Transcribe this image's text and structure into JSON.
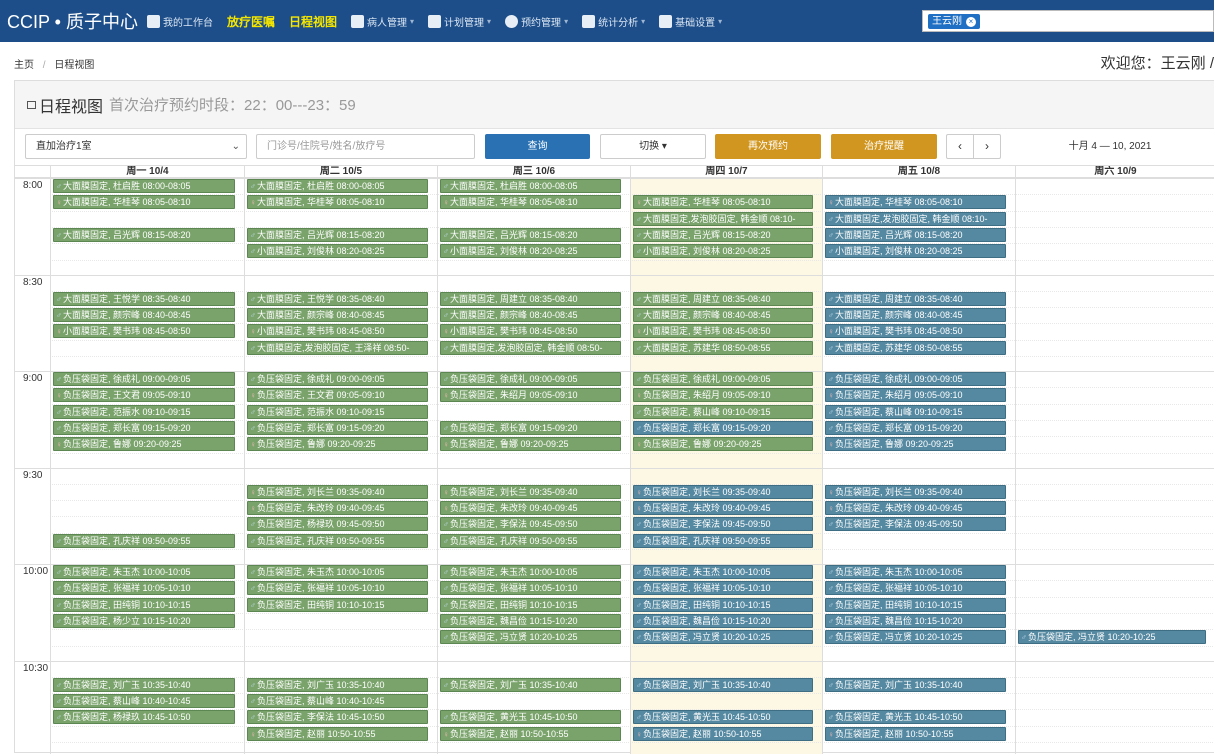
{
  "navbar": {
    "brand": "CCIP • 质子中心",
    "items": [
      {
        "label": "我的工作台",
        "icon": "home-icon",
        "highlight": false,
        "caret": false
      },
      {
        "label": "放疗医嘱",
        "icon": "",
        "highlight": true,
        "caret": false
      },
      {
        "label": "日程视图",
        "icon": "",
        "highlight": true,
        "caret": false
      },
      {
        "label": "病人管理",
        "icon": "user-icon",
        "highlight": false,
        "caret": true
      },
      {
        "label": "计划管理",
        "icon": "monitor-icon",
        "highlight": false,
        "caret": true
      },
      {
        "label": "预约管理",
        "icon": "clock-icon",
        "highlight": false,
        "caret": true
      },
      {
        "label": "统计分析",
        "icon": "bar-chart-icon",
        "highlight": false,
        "caret": true
      },
      {
        "label": "基础设置",
        "icon": "users-icon",
        "highlight": false,
        "caret": true
      }
    ],
    "user_tag": "王云刚",
    "user_tag_close": "×"
  },
  "breadcrumb": {
    "home": "主页",
    "separator": "/",
    "current": "日程视图"
  },
  "welcome": "欢迎您：王云刚 /",
  "panel": {
    "title": "日程视图",
    "subtitle": "首次治疗预约时段：22：00---23：59"
  },
  "toolbar": {
    "room_select": "直加治疗1室",
    "search_placeholder": "门诊号/住院号/姓名/放疗号",
    "query_button": "查询",
    "switch_button": "切换 ▾",
    "rebook_button": "再次预约",
    "remind_button": "治疗提醒",
    "prev_icon": "‹",
    "next_icon": "›",
    "date_range": "十月 4 — 10, 2021"
  },
  "calendar": {
    "today_col": 3,
    "days": [
      "周一 10/4",
      "周二 10/5",
      "周三 10/6",
      "周四 10/7",
      "周五 10/8",
      "周六 10/9"
    ],
    "time_labels": [
      "8:00",
      "8:30",
      "9:00",
      "9:30",
      "10:00",
      "10:30"
    ],
    "colors": {
      "green": "#7aa36b",
      "blue": "#5589a1",
      "today": "#fcf8e3",
      "nav": "#1d4e89"
    },
    "events": [
      {
        "d": 0,
        "s": 0,
        "t": "大面膜固定, 杜启胜 08:00-08:05",
        "c": "green",
        "sex": "m"
      },
      {
        "d": 0,
        "s": 1,
        "t": "大面膜固定, 华桂琴 08:05-08:10",
        "c": "green",
        "sex": "f"
      },
      {
        "d": 0,
        "s": 3,
        "t": "大面膜固定, 吕光辉 08:15-08:20",
        "c": "green",
        "sex": "m"
      },
      {
        "d": 0,
        "s": 7,
        "t": "大面膜固定, 王悦学 08:35-08:40",
        "c": "green",
        "sex": "m"
      },
      {
        "d": 0,
        "s": 8,
        "t": "大面膜固定, 颜宗峰 08:40-08:45",
        "c": "green",
        "sex": "m"
      },
      {
        "d": 0,
        "s": 9,
        "t": "小面膜固定, 樊书玮 08:45-08:50",
        "c": "green",
        "sex": "f"
      },
      {
        "d": 0,
        "s": 12,
        "t": "负压袋固定, 徐成礼 09:00-09:05",
        "c": "green",
        "sex": "m"
      },
      {
        "d": 0,
        "s": 13,
        "t": "负压袋固定, 王文君 09:05-09:10",
        "c": "green",
        "sex": "f"
      },
      {
        "d": 0,
        "s": 14,
        "t": "负压袋固定, 范振水 09:10-09:15",
        "c": "green",
        "sex": "m"
      },
      {
        "d": 0,
        "s": 15,
        "t": "负压袋固定, 郑长富 09:15-09:20",
        "c": "green",
        "sex": "m"
      },
      {
        "d": 0,
        "s": 16,
        "t": "负压袋固定, 鲁娜 09:20-09:25",
        "c": "green",
        "sex": "f"
      },
      {
        "d": 0,
        "s": 22,
        "t": "负压袋固定, 孔庆祥 09:50-09:55",
        "c": "green",
        "sex": "m"
      },
      {
        "d": 0,
        "s": 24,
        "t": "负压袋固定, 朱玉杰 10:00-10:05",
        "c": "green",
        "sex": "m"
      },
      {
        "d": 0,
        "s": 25,
        "t": "负压袋固定, 张福祥 10:05-10:10",
        "c": "green",
        "sex": "m"
      },
      {
        "d": 0,
        "s": 26,
        "t": "负压袋固定, 田纯铜 10:10-10:15",
        "c": "green",
        "sex": "m"
      },
      {
        "d": 0,
        "s": 27,
        "t": "负压袋固定, 杨少立 10:15-10:20",
        "c": "green",
        "sex": "m"
      },
      {
        "d": 0,
        "s": 31,
        "t": "负压袋固定, 刘广玉 10:35-10:40",
        "c": "green",
        "sex": "m"
      },
      {
        "d": 0,
        "s": 32,
        "t": "负压袋固定, 蔡山峰 10:40-10:45",
        "c": "green",
        "sex": "m"
      },
      {
        "d": 0,
        "s": 33,
        "t": "负压袋固定, 杨禄玖 10:45-10:50",
        "c": "green",
        "sex": "m"
      },
      {
        "d": 1,
        "s": 0,
        "t": "大面膜固定, 杜启胜 08:00-08:05",
        "c": "green",
        "sex": "m"
      },
      {
        "d": 1,
        "s": 1,
        "t": "大面膜固定, 华桂琴 08:05-08:10",
        "c": "green",
        "sex": "f"
      },
      {
        "d": 1,
        "s": 3,
        "t": "大面膜固定, 吕光辉 08:15-08:20",
        "c": "green",
        "sex": "m"
      },
      {
        "d": 1,
        "s": 4,
        "t": "小面膜固定, 刘俊林 08:20-08:25",
        "c": "green",
        "sex": "m"
      },
      {
        "d": 1,
        "s": 7,
        "t": "大面膜固定, 王悦学 08:35-08:40",
        "c": "green",
        "sex": "m"
      },
      {
        "d": 1,
        "s": 8,
        "t": "大面膜固定, 颜宗峰 08:40-08:45",
        "c": "green",
        "sex": "m"
      },
      {
        "d": 1,
        "s": 9,
        "t": "小面膜固定, 樊书玮 08:45-08:50",
        "c": "green",
        "sex": "f"
      },
      {
        "d": 1,
        "s": 10,
        "t": "大面膜固定,发泡胶固定, 王泽祥 08:50-",
        "c": "green",
        "sex": "m"
      },
      {
        "d": 1,
        "s": 12,
        "t": "负压袋固定, 徐成礼 09:00-09:05",
        "c": "green",
        "sex": "m"
      },
      {
        "d": 1,
        "s": 13,
        "t": "负压袋固定, 王文君 09:05-09:10",
        "c": "green",
        "sex": "f"
      },
      {
        "d": 1,
        "s": 14,
        "t": "负压袋固定, 范振水 09:10-09:15",
        "c": "green",
        "sex": "m"
      },
      {
        "d": 1,
        "s": 15,
        "t": "负压袋固定, 郑长富 09:15-09:20",
        "c": "green",
        "sex": "m"
      },
      {
        "d": 1,
        "s": 16,
        "t": "负压袋固定, 鲁娜 09:20-09:25",
        "c": "green",
        "sex": "f"
      },
      {
        "d": 1,
        "s": 19,
        "t": "负压袋固定, 刘长兰 09:35-09:40",
        "c": "green",
        "sex": "f"
      },
      {
        "d": 1,
        "s": 20,
        "t": "负压袋固定, 朱改玲 09:40-09:45",
        "c": "green",
        "sex": "f"
      },
      {
        "d": 1,
        "s": 21,
        "t": "负压袋固定, 杨禄玖 09:45-09:50",
        "c": "green",
        "sex": "m"
      },
      {
        "d": 1,
        "s": 22,
        "t": "负压袋固定, 孔庆祥 09:50-09:55",
        "c": "green",
        "sex": "m"
      },
      {
        "d": 1,
        "s": 24,
        "t": "负压袋固定, 朱玉杰 10:00-10:05",
        "c": "green",
        "sex": "m"
      },
      {
        "d": 1,
        "s": 25,
        "t": "负压袋固定, 张福祥 10:05-10:10",
        "c": "green",
        "sex": "m"
      },
      {
        "d": 1,
        "s": 26,
        "t": "负压袋固定, 田纯铜 10:10-10:15",
        "c": "green",
        "sex": "m"
      },
      {
        "d": 1,
        "s": 31,
        "t": "负压袋固定, 刘广玉 10:35-10:40",
        "c": "green",
        "sex": "m"
      },
      {
        "d": 1,
        "s": 32,
        "t": "负压袋固定, 蔡山峰 10:40-10:45",
        "c": "green",
        "sex": "m"
      },
      {
        "d": 1,
        "s": 33,
        "t": "负压袋固定, 李保法 10:45-10:50",
        "c": "green",
        "sex": "m"
      },
      {
        "d": 1,
        "s": 34,
        "t": "负压袋固定, 赵丽 10:50-10:55",
        "c": "green",
        "sex": "f"
      },
      {
        "d": 2,
        "s": 0,
        "t": "大面膜固定, 杜启胜 08:00-08:05",
        "c": "green",
        "sex": "m"
      },
      {
        "d": 2,
        "s": 1,
        "t": "大面膜固定, 华桂琴 08:05-08:10",
        "c": "green",
        "sex": "f"
      },
      {
        "d": 2,
        "s": 3,
        "t": "大面膜固定, 吕光辉 08:15-08:20",
        "c": "green",
        "sex": "m"
      },
      {
        "d": 2,
        "s": 4,
        "t": "小面膜固定, 刘俊林 08:20-08:25",
        "c": "green",
        "sex": "m"
      },
      {
        "d": 2,
        "s": 7,
        "t": "大面膜固定, 周建立 08:35-08:40",
        "c": "green",
        "sex": "m"
      },
      {
        "d": 2,
        "s": 8,
        "t": "大面膜固定, 颜宗峰 08:40-08:45",
        "c": "green",
        "sex": "m"
      },
      {
        "d": 2,
        "s": 9,
        "t": "小面膜固定, 樊书玮 08:45-08:50",
        "c": "green",
        "sex": "f"
      },
      {
        "d": 2,
        "s": 10,
        "t": "大面膜固定,发泡胶固定, 韩金顺 08:50-",
        "c": "green",
        "sex": "m"
      },
      {
        "d": 2,
        "s": 12,
        "t": "负压袋固定, 徐成礼 09:00-09:05",
        "c": "green",
        "sex": "m"
      },
      {
        "d": 2,
        "s": 13,
        "t": "负压袋固定, 朱绍月 09:05-09:10",
        "c": "green",
        "sex": "f"
      },
      {
        "d": 2,
        "s": 15,
        "t": "负压袋固定, 郑长富 09:15-09:20",
        "c": "green",
        "sex": "m"
      },
      {
        "d": 2,
        "s": 16,
        "t": "负压袋固定, 鲁娜 09:20-09:25",
        "c": "green",
        "sex": "f"
      },
      {
        "d": 2,
        "s": 19,
        "t": "负压袋固定, 刘长兰 09:35-09:40",
        "c": "green",
        "sex": "f"
      },
      {
        "d": 2,
        "s": 20,
        "t": "负压袋固定, 朱改玲 09:40-09:45",
        "c": "green",
        "sex": "f"
      },
      {
        "d": 2,
        "s": 21,
        "t": "负压袋固定, 李保法 09:45-09:50",
        "c": "green",
        "sex": "m"
      },
      {
        "d": 2,
        "s": 22,
        "t": "负压袋固定, 孔庆祥 09:50-09:55",
        "c": "green",
        "sex": "m"
      },
      {
        "d": 2,
        "s": 24,
        "t": "负压袋固定, 朱玉杰 10:00-10:05",
        "c": "green",
        "sex": "m"
      },
      {
        "d": 2,
        "s": 25,
        "t": "负压袋固定, 张福祥 10:05-10:10",
        "c": "green",
        "sex": "m"
      },
      {
        "d": 2,
        "s": 26,
        "t": "负压袋固定, 田纯铜 10:10-10:15",
        "c": "green",
        "sex": "m"
      },
      {
        "d": 2,
        "s": 27,
        "t": "负压袋固定, 魏昌俭 10:15-10:20",
        "c": "green",
        "sex": "m"
      },
      {
        "d": 2,
        "s": 28,
        "t": "负压袋固定, 冯立贤 10:20-10:25",
        "c": "green",
        "sex": "m"
      },
      {
        "d": 2,
        "s": 31,
        "t": "负压袋固定, 刘广玉 10:35-10:40",
        "c": "green",
        "sex": "m"
      },
      {
        "d": 2,
        "s": 33,
        "t": "负压袋固定, 黄光玉 10:45-10:50",
        "c": "green",
        "sex": "m"
      },
      {
        "d": 2,
        "s": 34,
        "t": "负压袋固定, 赵丽 10:50-10:55",
        "c": "green",
        "sex": "f"
      },
      {
        "d": 3,
        "s": 1,
        "t": "大面膜固定, 华桂琴 08:05-08:10",
        "c": "green",
        "sex": "f"
      },
      {
        "d": 3,
        "s": 2,
        "t": "大面膜固定,发泡胶固定, 韩金顺 08:10-",
        "c": "green",
        "sex": "m"
      },
      {
        "d": 3,
        "s": 3,
        "t": "大面膜固定, 吕光辉 08:15-08:20",
        "c": "green",
        "sex": "m"
      },
      {
        "d": 3,
        "s": 4,
        "t": "小面膜固定, 刘俊林 08:20-08:25",
        "c": "green",
        "sex": "m"
      },
      {
        "d": 3,
        "s": 7,
        "t": "大面膜固定, 周建立 08:35-08:40",
        "c": "green",
        "sex": "m"
      },
      {
        "d": 3,
        "s": 8,
        "t": "大面膜固定, 颜宗峰 08:40-08:45",
        "c": "green",
        "sex": "m"
      },
      {
        "d": 3,
        "s": 9,
        "t": "小面膜固定, 樊书玮 08:45-08:50",
        "c": "green",
        "sex": "f"
      },
      {
        "d": 3,
        "s": 10,
        "t": "大面膜固定, 苏建华 08:50-08:55",
        "c": "green",
        "sex": "m"
      },
      {
        "d": 3,
        "s": 12,
        "t": "负压袋固定, 徐成礼 09:00-09:05",
        "c": "green",
        "sex": "m"
      },
      {
        "d": 3,
        "s": 13,
        "t": "负压袋固定, 朱绍月 09:05-09:10",
        "c": "green",
        "sex": "f"
      },
      {
        "d": 3,
        "s": 14,
        "t": "负压袋固定, 蔡山峰 09:10-09:15",
        "c": "green",
        "sex": "m"
      },
      {
        "d": 3,
        "s": 15,
        "t": "负压袋固定, 郑长富 09:15-09:20",
        "c": "blue",
        "sex": "m"
      },
      {
        "d": 3,
        "s": 16,
        "t": "负压袋固定, 鲁娜 09:20-09:25",
        "c": "green",
        "sex": "f"
      },
      {
        "d": 3,
        "s": 19,
        "t": "负压袋固定, 刘长兰 09:35-09:40",
        "c": "blue",
        "sex": "f"
      },
      {
        "d": 3,
        "s": 20,
        "t": "负压袋固定, 朱改玲 09:40-09:45",
        "c": "blue",
        "sex": "f"
      },
      {
        "d": 3,
        "s": 21,
        "t": "负压袋固定, 李保法 09:45-09:50",
        "c": "blue",
        "sex": "m"
      },
      {
        "d": 3,
        "s": 22,
        "t": "负压袋固定, 孔庆祥 09:50-09:55",
        "c": "blue",
        "sex": "m"
      },
      {
        "d": 3,
        "s": 24,
        "t": "负压袋固定, 朱玉杰 10:00-10:05",
        "c": "blue",
        "sex": "m"
      },
      {
        "d": 3,
        "s": 25,
        "t": "负压袋固定, 张福祥 10:05-10:10",
        "c": "blue",
        "sex": "m"
      },
      {
        "d": 3,
        "s": 26,
        "t": "负压袋固定, 田纯铜 10:10-10:15",
        "c": "blue",
        "sex": "m"
      },
      {
        "d": 3,
        "s": 27,
        "t": "负压袋固定, 魏昌俭 10:15-10:20",
        "c": "blue",
        "sex": "m"
      },
      {
        "d": 3,
        "s": 28,
        "t": "负压袋固定, 冯立贤 10:20-10:25",
        "c": "blue",
        "sex": "m"
      },
      {
        "d": 3,
        "s": 31,
        "t": "负压袋固定, 刘广玉 10:35-10:40",
        "c": "blue",
        "sex": "m"
      },
      {
        "d": 3,
        "s": 33,
        "t": "负压袋固定, 黄光玉 10:45-10:50",
        "c": "blue",
        "sex": "m"
      },
      {
        "d": 3,
        "s": 34,
        "t": "负压袋固定, 赵丽 10:50-10:55",
        "c": "blue",
        "sex": "f"
      },
      {
        "d": 4,
        "s": 1,
        "t": "大面膜固定, 华桂琴 08:05-08:10",
        "c": "blue",
        "sex": "f"
      },
      {
        "d": 4,
        "s": 2,
        "t": "大面膜固定,发泡胶固定, 韩金顺 08:10-",
        "c": "blue",
        "sex": "m"
      },
      {
        "d": 4,
        "s": 3,
        "t": "大面膜固定, 吕光辉 08:15-08:20",
        "c": "blue",
        "sex": "m"
      },
      {
        "d": 4,
        "s": 4,
        "t": "小面膜固定, 刘俊林 08:20-08:25",
        "c": "blue",
        "sex": "m"
      },
      {
        "d": 4,
        "s": 7,
        "t": "大面膜固定, 周建立 08:35-08:40",
        "c": "blue",
        "sex": "m"
      },
      {
        "d": 4,
        "s": 8,
        "t": "大面膜固定, 颜宗峰 08:40-08:45",
        "c": "blue",
        "sex": "m"
      },
      {
        "d": 4,
        "s": 9,
        "t": "小面膜固定, 樊书玮 08:45-08:50",
        "c": "blue",
        "sex": "f"
      },
      {
        "d": 4,
        "s": 10,
        "t": "大面膜固定, 苏建华 08:50-08:55",
        "c": "blue",
        "sex": "m"
      },
      {
        "d": 4,
        "s": 12,
        "t": "负压袋固定, 徐成礼 09:00-09:05",
        "c": "blue",
        "sex": "m"
      },
      {
        "d": 4,
        "s": 13,
        "t": "负压袋固定, 朱绍月 09:05-09:10",
        "c": "blue",
        "sex": "f"
      },
      {
        "d": 4,
        "s": 14,
        "t": "负压袋固定, 蔡山峰 09:10-09:15",
        "c": "blue",
        "sex": "m"
      },
      {
        "d": 4,
        "s": 15,
        "t": "负压袋固定, 郑长富 09:15-09:20",
        "c": "blue",
        "sex": "m"
      },
      {
        "d": 4,
        "s": 16,
        "t": "负压袋固定, 鲁娜 09:20-09:25",
        "c": "blue",
        "sex": "f"
      },
      {
        "d": 4,
        "s": 19,
        "t": "负压袋固定, 刘长兰 09:35-09:40",
        "c": "blue",
        "sex": "f"
      },
      {
        "d": 4,
        "s": 20,
        "t": "负压袋固定, 朱改玲 09:40-09:45",
        "c": "blue",
        "sex": "f"
      },
      {
        "d": 4,
        "s": 21,
        "t": "负压袋固定, 李保法 09:45-09:50",
        "c": "blue",
        "sex": "m"
      },
      {
        "d": 4,
        "s": 24,
        "t": "负压袋固定, 朱玉杰 10:00-10:05",
        "c": "blue",
        "sex": "m"
      },
      {
        "d": 4,
        "s": 25,
        "t": "负压袋固定, 张福祥 10:05-10:10",
        "c": "blue",
        "sex": "m"
      },
      {
        "d": 4,
        "s": 26,
        "t": "负压袋固定, 田纯铜 10:10-10:15",
        "c": "blue",
        "sex": "m"
      },
      {
        "d": 4,
        "s": 27,
        "t": "负压袋固定, 魏昌俭 10:15-10:20",
        "c": "blue",
        "sex": "m"
      },
      {
        "d": 4,
        "s": 28,
        "t": "负压袋固定, 冯立贤 10:20-10:25",
        "c": "blue",
        "sex": "m"
      },
      {
        "d": 4,
        "s": 31,
        "t": "负压袋固定, 刘广玉 10:35-10:40",
        "c": "blue",
        "sex": "m"
      },
      {
        "d": 4,
        "s": 33,
        "t": "负压袋固定, 黄光玉 10:45-10:50",
        "c": "blue",
        "sex": "m"
      },
      {
        "d": 4,
        "s": 34,
        "t": "负压袋固定, 赵丽 10:50-10:55",
        "c": "blue",
        "sex": "f"
      },
      {
        "d": 5,
        "s": 28,
        "t": "负压袋固定, 冯立贤 10:20-10:25",
        "c": "blue",
        "sex": "m"
      }
    ]
  }
}
